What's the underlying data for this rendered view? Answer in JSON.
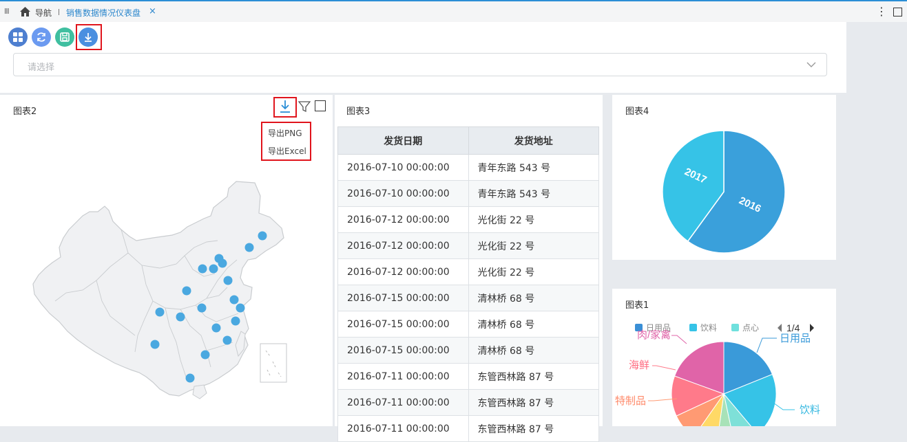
{
  "tabbar": {
    "grip": "III",
    "nav_label": "导航",
    "tab_title": "销售数据情况仪表盘",
    "close": "×",
    "more": "⋮"
  },
  "toolbar": {
    "buttons": [
      {
        "icon": "grid-icon",
        "color": "#4e7fd0"
      },
      {
        "icon": "refresh-icon",
        "color": "#6b9af0"
      },
      {
        "icon": "save-icon",
        "color": "#3fbfa0"
      },
      {
        "icon": "download-icon",
        "color": "#4a8fe0"
      }
    ],
    "select_placeholder": "请选择"
  },
  "chart2": {
    "title": "图表2",
    "export_menu": {
      "png": "导出PNG",
      "excel": "导出Excel"
    },
    "point_color": "#4aa8e0"
  },
  "chart3": {
    "title": "图表3",
    "columns": [
      "发货日期",
      "发货地址"
    ],
    "rows": [
      [
        "2016-07-10 00:00:00",
        "青年东路 543 号"
      ],
      [
        "2016-07-10 00:00:00",
        "青年东路 543 号"
      ],
      [
        "2016-07-12 00:00:00",
        "光化街 22 号"
      ],
      [
        "2016-07-12 00:00:00",
        "光化街 22 号"
      ],
      [
        "2016-07-12 00:00:00",
        "光化街 22 号"
      ],
      [
        "2016-07-15 00:00:00",
        "清林桥 68 号"
      ],
      [
        "2016-07-15 00:00:00",
        "清林桥 68 号"
      ],
      [
        "2016-07-15 00:00:00",
        "清林桥 68 号"
      ],
      [
        "2016-07-11 00:00:00",
        "东管西林路 87 号"
      ],
      [
        "2016-07-11 00:00:00",
        "东管西林路 87 号"
      ],
      [
        "2016-07-11 00:00:00",
        "东管西林路 87 号"
      ]
    ]
  },
  "chart4": {
    "title": "图表4",
    "slices": [
      {
        "label": "2016",
        "share": 0.6,
        "color": "#3aa0db"
      },
      {
        "label": "2017",
        "share": 0.4,
        "color": "#36c3e7"
      }
    ]
  },
  "chart1": {
    "title": "图表1",
    "legend": [
      {
        "label": "日用品",
        "color": "#3a8fd6"
      },
      {
        "label": "饮料",
        "color": "#36c3e7"
      },
      {
        "label": "点心",
        "color": "#6fe0dd"
      }
    ],
    "pager": "1/4",
    "labels": {
      "daily": "日用品",
      "drink": "饮料",
      "meat": "肉/家禽",
      "seafood": "海鲜",
      "special": "特制品"
    },
    "colors": {
      "daily": "#3a9ad9",
      "drink": "#36c3e7",
      "snack": "#7ee0d8",
      "grain": "#a8e2b8",
      "cond": "#ffd966",
      "special": "#ff9a73",
      "seafood": "#ff7a8a",
      "meat": "#e064a8"
    }
  }
}
